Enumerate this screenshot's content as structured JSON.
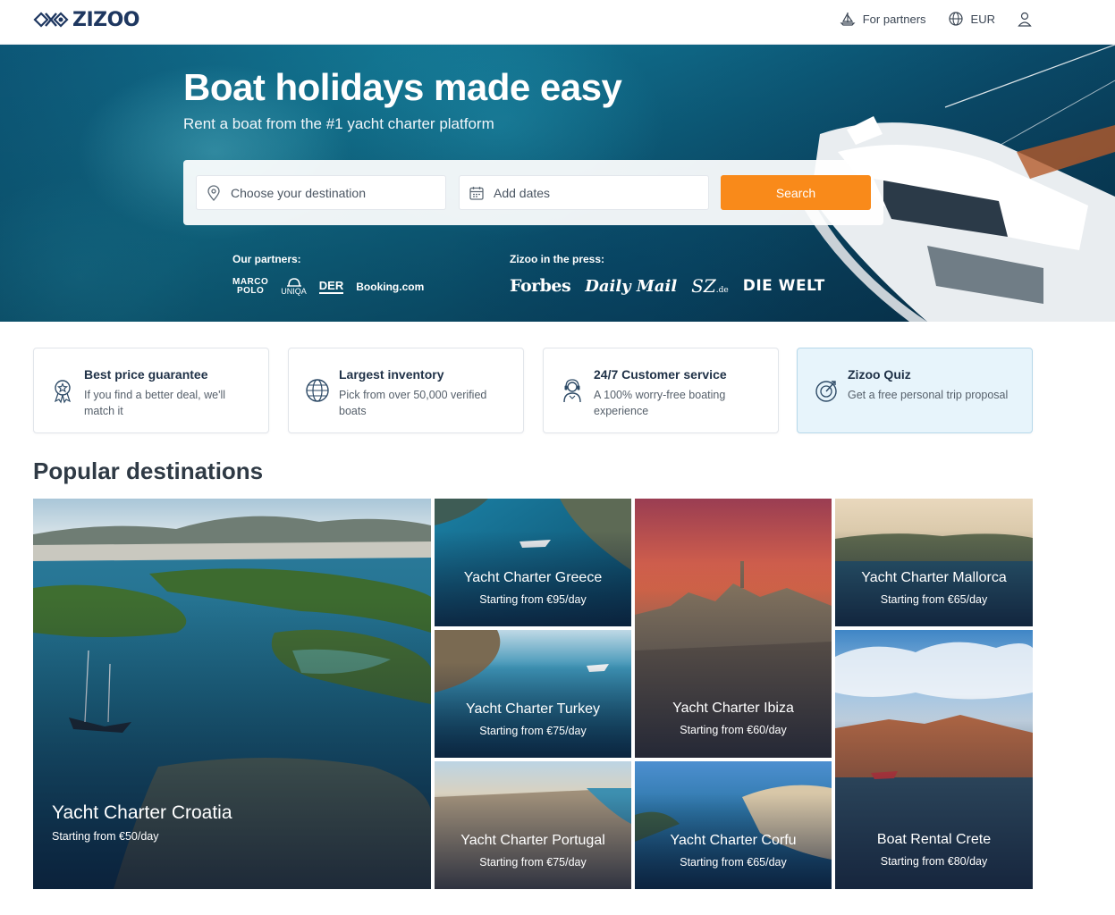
{
  "header": {
    "logo_text": "ZIZOO",
    "for_partners": "For partners",
    "currency": "EUR"
  },
  "hero": {
    "title": "Boat holidays made easy",
    "subtitle": "Rent a boat from the #1 yacht charter platform",
    "search": {
      "destination_placeholder": "Choose your destination",
      "dates_placeholder": "Add dates",
      "button_label": "Search"
    },
    "partners_label": "Our partners:",
    "partners": [
      {
        "line1": "MARCO",
        "line2": "POLO"
      },
      {
        "text": "UNIQA"
      },
      {
        "text": "DER"
      },
      {
        "text": "Booking.com"
      }
    ],
    "press_label": "Zizoo in the press:",
    "press": [
      "Forbes",
      "Daily Mail",
      "SZ",
      ".de",
      "DIE WELT"
    ]
  },
  "features": [
    {
      "title": "Best price guarantee",
      "description": "If you find a better deal, we'll match it",
      "icon": "badge-star-icon"
    },
    {
      "title": "Largest inventory",
      "description": "Pick from over 50,000 verified boats",
      "icon": "globe-icon"
    },
    {
      "title": "24/7 Customer service",
      "description": "A 100% worry-free boating experience",
      "icon": "support-agent-icon"
    },
    {
      "title": "Zizoo Quiz",
      "description": "Get a free personal trip proposal",
      "icon": "compass-target-icon"
    }
  ],
  "destinations_title": "Popular destinations",
  "destinations": [
    {
      "name": "Yacht Charter Croatia",
      "price": "Starting from €50/day"
    },
    {
      "name": "Yacht Charter Greece",
      "price": "Starting from €95/day"
    },
    {
      "name": "Yacht Charter Ibiza",
      "price": "Starting from €60/day"
    },
    {
      "name": "Yacht Charter Mallorca",
      "price": "Starting from €65/day"
    },
    {
      "name": "Yacht Charter Turkey",
      "price": "Starting from €75/day"
    },
    {
      "name": "Boat Rental Crete",
      "price": "Starting from €80/day"
    },
    {
      "name": "Yacht Charter Portugal",
      "price": "Starting from €75/day"
    },
    {
      "name": "Yacht Charter Corfu",
      "price": "Starting from €65/day"
    }
  ],
  "colors": {
    "accent": "#f98a1a",
    "brand_navy": "#1e3760",
    "quiz_bg": "#e7f4fb"
  }
}
